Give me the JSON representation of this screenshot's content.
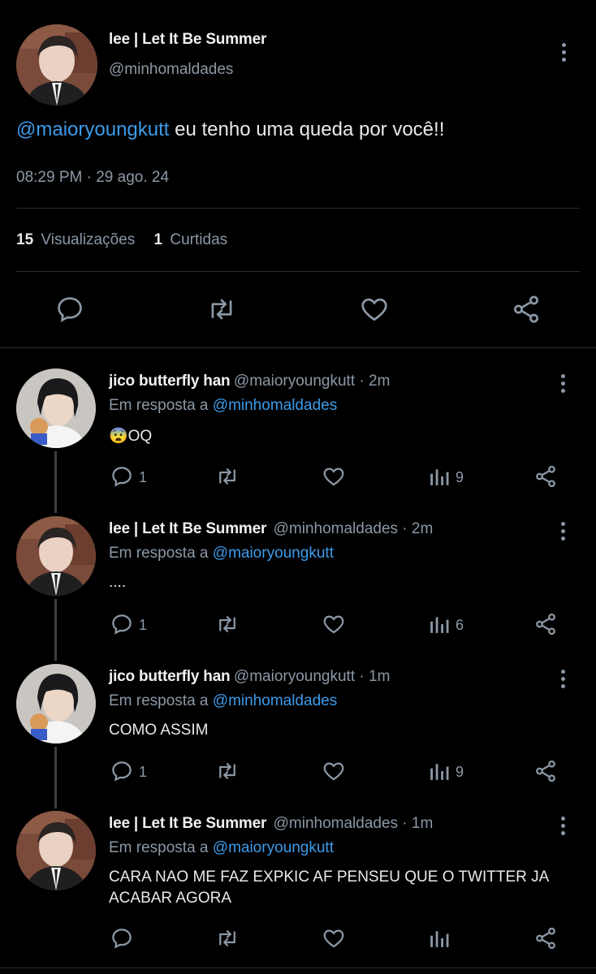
{
  "main_tweet": {
    "display_name": "lee | Let It Be Summer",
    "handle": "@minhomaldades",
    "mention": "@maioryoungkutt",
    "text": " eu tenho uma queda por você!!",
    "timestamp": "08:29 PM · 29 ago. 24",
    "views_count": "15",
    "views_label": "Visualizações",
    "likes_count": "1",
    "likes_label": "Curtidas"
  },
  "replies": [
    {
      "display_name": "jico butterfly han",
      "handle_time": "@maioryoungkutt · 2m",
      "reply_prefix": "Em resposta a",
      "reply_to": "@minhomaldades",
      "text": "😨OQ",
      "reply_count": "1",
      "views": "9"
    },
    {
      "display_name": "lee | Let It Be Summer",
      "handle_time": "@minhomaldades · 2m",
      "reply_prefix": "Em resposta a",
      "reply_to": "@maioryoungkutt",
      "text": "....",
      "reply_count": "1",
      "views": "6"
    },
    {
      "display_name": "jico butterfly han",
      "handle_time": "@maioryoungkutt · 1m",
      "reply_prefix": "Em resposta a",
      "reply_to": "@minhomaldades",
      "text": "COMO ASSIM",
      "reply_count": "1",
      "views": "9"
    },
    {
      "display_name": "lee | Let It Be Summer",
      "handle_time": "@minhomaldades · 1m",
      "reply_prefix": "Em resposta a",
      "reply_to": "@maioryoungkutt",
      "text_line1": "CARA NAO ME FAZ EXPKIC AF PENSEU QUE O TWITTER JA",
      "text_line2": "ACABAR AGORA"
    }
  ],
  "colors": {
    "background": "#000000",
    "link": "#3d9be9",
    "muted": "#8b98a5",
    "divider": "#2a2e33"
  }
}
